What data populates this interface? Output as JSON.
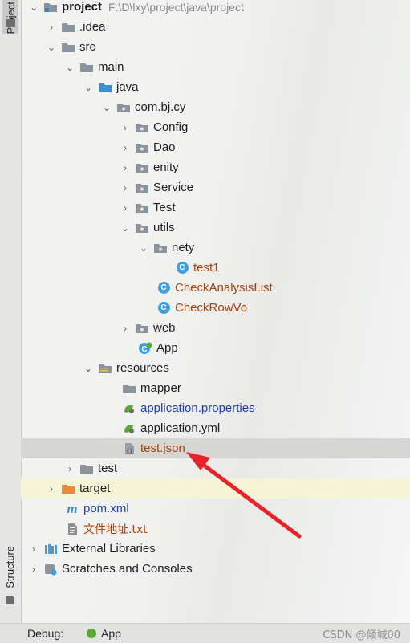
{
  "side_tabs": {
    "project": "Project",
    "structure": "Structure"
  },
  "project": {
    "name": "project",
    "path": "F:\\D\\lxy\\project\\java\\project"
  },
  "tree": {
    "idea": ".idea",
    "src": "src",
    "main": "main",
    "java": "java",
    "package": "com.bj.cy",
    "config": "Config",
    "dao": "Dao",
    "enity": "enity",
    "service": "Service",
    "test_pkg": "Test",
    "utils": "utils",
    "nety": "nety",
    "test1": "test1",
    "check_analysis_list": "CheckAnalysisList",
    "check_row_vo": "CheckRowVo",
    "web": "web",
    "app": "App",
    "resources": "resources",
    "mapper": "mapper",
    "application_properties": "application.properties",
    "application_yml": "application.yml",
    "test_json": "test.json",
    "test_dir": "test",
    "target": "target",
    "pom": "pom.xml",
    "txt": "文件地址.txt",
    "external_libraries": "External Libraries",
    "scratches": "Scratches and Consoles"
  },
  "debug_bar": {
    "label": "Debug:",
    "config": "App"
  },
  "watermark": "CSDN @倾城00",
  "colors": {
    "arrow": "#e8242a",
    "selected_row": "#d6d6d4",
    "folder": "#8a949c",
    "class_icon": "#3d9fe0"
  }
}
